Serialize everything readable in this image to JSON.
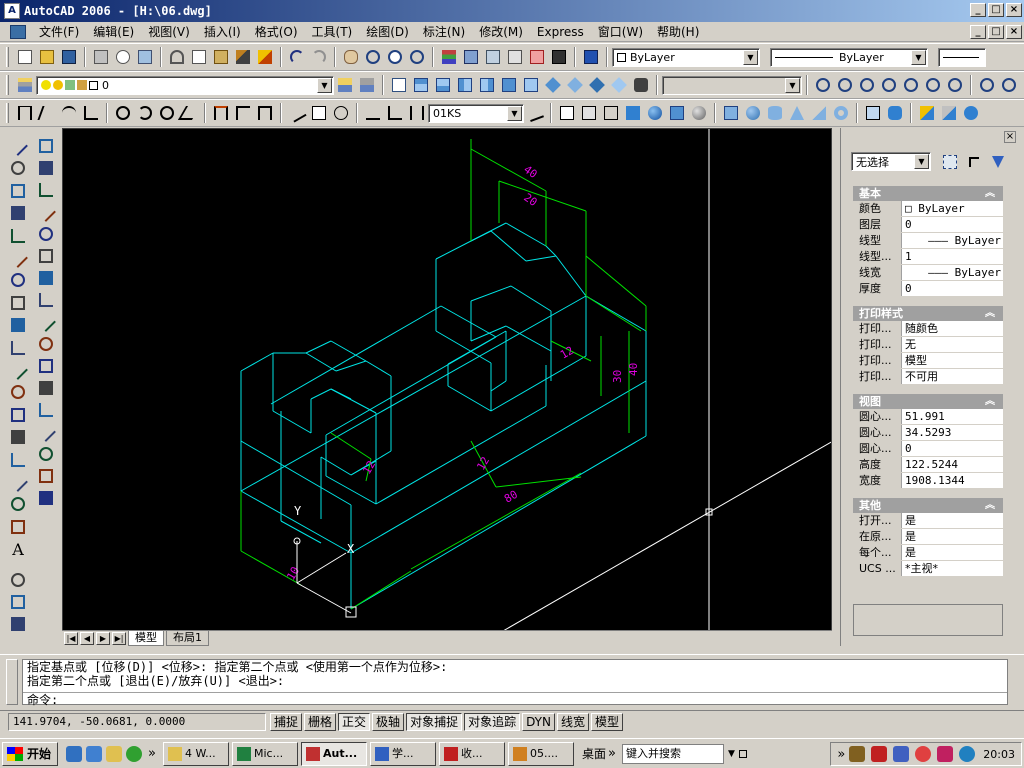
{
  "window": {
    "title": "AutoCAD 2006 - [H:\\06.dwg]",
    "min_glyph": "_",
    "max_glyph": "□",
    "close_glyph": "×"
  },
  "menu": [
    "文件(F)",
    "编辑(E)",
    "视图(V)",
    "插入(I)",
    "格式(O)",
    "工具(T)",
    "绘图(D)",
    "标注(N)",
    "修改(M)",
    "Express",
    "窗口(W)",
    "帮助(H)"
  ],
  "toolbar1": {
    "color_combo": "ByLayer",
    "linetype_combo": "ByLayer"
  },
  "toolbar2": {
    "layer_combo": "0"
  },
  "toolbar3": {
    "dimstyle_combo": "01KS"
  },
  "properties": {
    "selection": "无选择",
    "close_glyph": "×",
    "sections": [
      {
        "title": "基本",
        "rows": [
          {
            "key": "颜色",
            "value": "□ ByLayer"
          },
          {
            "key": "图层",
            "value": "0"
          },
          {
            "key": "线型",
            "value": "——— ByLayer"
          },
          {
            "key": "线型...",
            "value": "1"
          },
          {
            "key": "线宽",
            "value": "——— ByLayer"
          },
          {
            "key": "厚度",
            "value": "0"
          }
        ]
      },
      {
        "title": "打印样式",
        "rows": [
          {
            "key": "打印...",
            "value": "随颜色"
          },
          {
            "key": "打印...",
            "value": "无"
          },
          {
            "key": "打印...",
            "value": "模型"
          },
          {
            "key": "打印...",
            "value": "不可用"
          }
        ]
      },
      {
        "title": "视图",
        "rows": [
          {
            "key": "圆心...",
            "value": "51.991"
          },
          {
            "key": "圆心...",
            "value": "34.5293"
          },
          {
            "key": "圆心...",
            "value": "0"
          },
          {
            "key": "高度",
            "value": "122.5244"
          },
          {
            "key": "宽度",
            "value": "1908.1344"
          }
        ]
      },
      {
        "title": "其他",
        "rows": [
          {
            "key": "打开...",
            "value": "是"
          },
          {
            "key": "在原...",
            "value": "是"
          },
          {
            "key": "每个...",
            "value": "是"
          },
          {
            "key": "UCS ...",
            "value": "*主视*"
          }
        ]
      }
    ]
  },
  "drawing": {
    "dims": [
      "40",
      "20",
      "12",
      "40",
      "30",
      "12",
      "12",
      "80",
      "10"
    ],
    "ucs_x": "X",
    "ucs_y": "Y"
  },
  "layout_tabs": [
    "模型",
    "布局1"
  ],
  "command": {
    "line1": "指定基点或 [位移(D)] <位移>:  指定第二个点或 <使用第一个点作为位移>:",
    "line2": "指定第二个点或 [退出(E)/放弃(U)] <退出>:",
    "prompt": "命令:"
  },
  "status": {
    "coords": "141.9704, -50.0681, 0.0000",
    "buttons": [
      {
        "label": "捕捉",
        "on": false
      },
      {
        "label": "栅格",
        "on": false
      },
      {
        "label": "正交",
        "on": true
      },
      {
        "label": "极轴",
        "on": false
      },
      {
        "label": "对象捕捉",
        "on": true
      },
      {
        "label": "对象追踪",
        "on": true
      },
      {
        "label": "DYN",
        "on": false
      },
      {
        "label": "线宽",
        "on": false
      },
      {
        "label": "模型",
        "on": false
      }
    ]
  },
  "taskbar": {
    "start": "开始",
    "tasks": [
      "4 W...",
      "Mic...",
      "Aut...",
      "学...",
      "收...",
      "05...."
    ],
    "desktop": "桌面",
    "search_placeholder": "键入并搜索",
    "clock": "20:03",
    "more_glyph": "»"
  },
  "colors": {
    "cyan": "#00e5e5",
    "green": "#00e000",
    "magenta": "#e000e0",
    "title_start": "#0a246a",
    "title_end": "#a6caf0"
  }
}
